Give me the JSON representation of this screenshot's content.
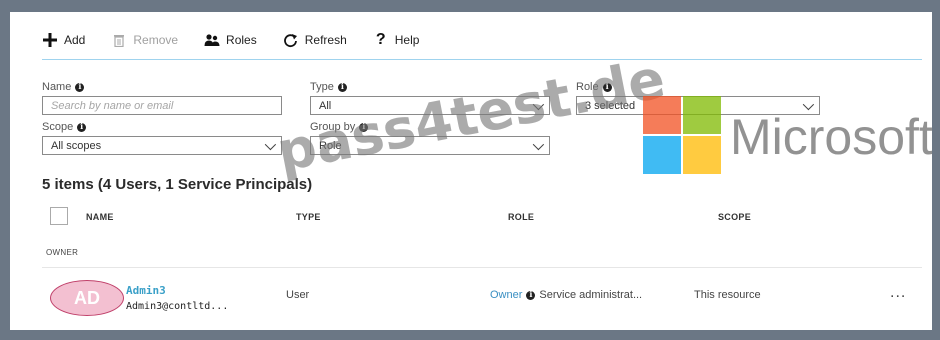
{
  "toolbar": {
    "add_label": "Add",
    "remove_label": "Remove",
    "roles_label": "Roles",
    "refresh_label": "Refresh",
    "help_label": "Help"
  },
  "filters": {
    "name_label": "Name",
    "name_placeholder": "Search by name or email",
    "type_label": "Type",
    "type_value": "All",
    "role_label": "Role",
    "role_value": "3 selected",
    "scope_label": "Scope",
    "scope_value": "All scopes",
    "groupby_label": "Group by",
    "groupby_value": "Role"
  },
  "summary": "5 items (4 Users, 1 Service Principals)",
  "table": {
    "headers": {
      "name": "NAME",
      "type": "TYPE",
      "role": "ROLE",
      "scope": "SCOPE",
      "owner": "OWNER"
    },
    "rows": [
      {
        "initials": "AD",
        "name": "Admin3",
        "email": "Admin3@contltd...",
        "type": "User",
        "role": "Owner",
        "role_note": "Service administrat...",
        "scope": "This resource",
        "more": "..."
      }
    ]
  },
  "watermark": {
    "text": "pass4test.de",
    "brand": "Microsoft",
    "logo_colors": [
      "#f25022",
      "#7fba00",
      "#00a4ef",
      "#ffb900"
    ]
  }
}
